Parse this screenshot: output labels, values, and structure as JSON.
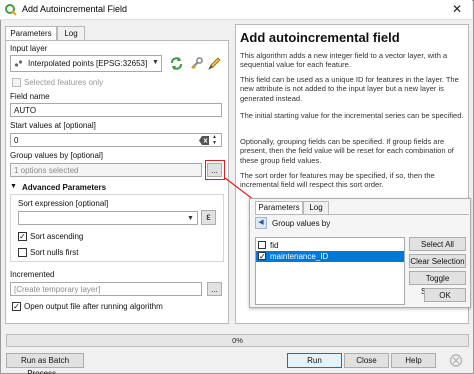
{
  "window": {
    "title": "Add Autoincremental Field",
    "close_symbol": "✕"
  },
  "tabs": [
    {
      "label": "Parameters"
    },
    {
      "label": "Log"
    }
  ],
  "params": {
    "input_layer_label": "Input layer",
    "input_layer_value": "Interpolated points [EPSG:32653]",
    "selected_only_label": "Selected features only",
    "field_name_label": "Field name",
    "field_name_value": "AUTO",
    "start_label": "Start values at [optional]",
    "start_value": "0",
    "group_label": "Group values by [optional]",
    "group_value": "1 options selected",
    "ellipsis": "...",
    "advanced_label": "Advanced Parameters",
    "sort_expr_label": "Sort expression [optional]",
    "sort_expr_value": "",
    "expr_symbol": "ε",
    "sort_asc_label": "Sort ascending",
    "sort_nulls_label": "Sort nulls first",
    "incremented_label": "Incremented",
    "incremented_placeholder": "[Create temporary layer]",
    "open_output_label": "Open output file after running algorithm",
    "checkmark": "✓"
  },
  "help": {
    "title": "Add autoincremental field",
    "paragraphs": [
      "This algorithm adds a new integer field to a vector layer, with a sequential value for each feature.",
      "This field can be used as a unique ID for features in the layer. The new attribute is not added to the input layer but a new layer is generated instead.",
      "The initial starting value for the incremental series can be specified.",
      "Optionally, grouping fields can be specified. If group fields are present, then the field value will be reset for each combination of these group field values.",
      "The sort order for features may be specified, if so, then the incremental field will respect this sort order."
    ]
  },
  "progress": {
    "text": "0%",
    "value": 0
  },
  "buttons": {
    "batch": "Run as Batch Process...",
    "run": "Run",
    "close": "Close",
    "help": "Help"
  },
  "overlay": {
    "tabs": [
      {
        "label": "Parameters"
      },
      {
        "label": "Log"
      }
    ],
    "back_symbol": "◀",
    "header": "Group values by",
    "items": [
      {
        "label": "fid",
        "checked": false
      },
      {
        "label": "maintenance_ID",
        "checked": true
      }
    ],
    "select_all": "Select All",
    "clear_selection": "Clear Selection",
    "toggle_selection": "Toggle Selection",
    "ok": "OK"
  },
  "colors": {
    "accent": "#0078d7",
    "annotation": "#e02020",
    "icon_green": "#3c9a3c"
  }
}
